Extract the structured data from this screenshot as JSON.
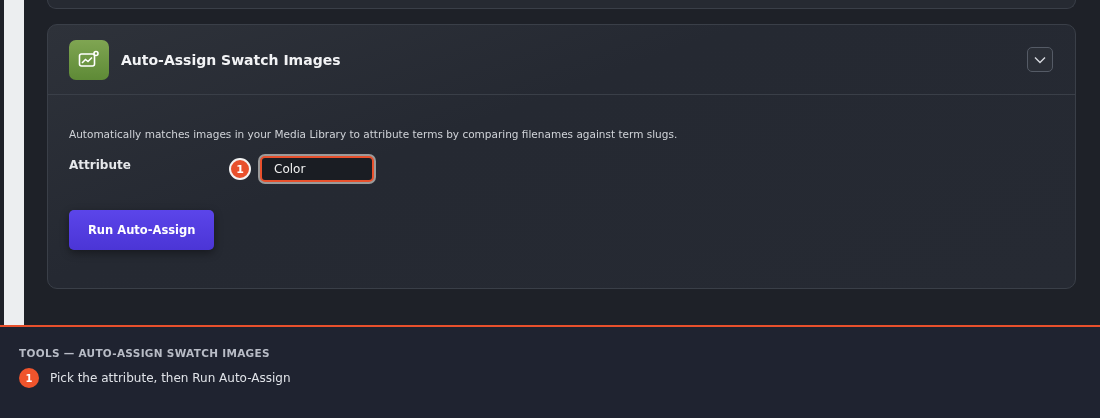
{
  "panel": {
    "title": "Auto-Assign Swatch Images",
    "expanded": true,
    "description": "Automatically matches images in your Media Library to attribute terms by comparing filenames against term slugs.",
    "fields": [
      {
        "label": "Attribute",
        "value": "Color",
        "callout": "1",
        "highlighted": true
      }
    ],
    "button": "Run Auto-Assign"
  },
  "guide": {
    "heading": "TOOLS — AUTO-ASSIGN SWATCH IMAGES",
    "steps": [
      {
        "number": "1",
        "text": "Pick the attribute, then Run Auto-Assign"
      }
    ]
  }
}
